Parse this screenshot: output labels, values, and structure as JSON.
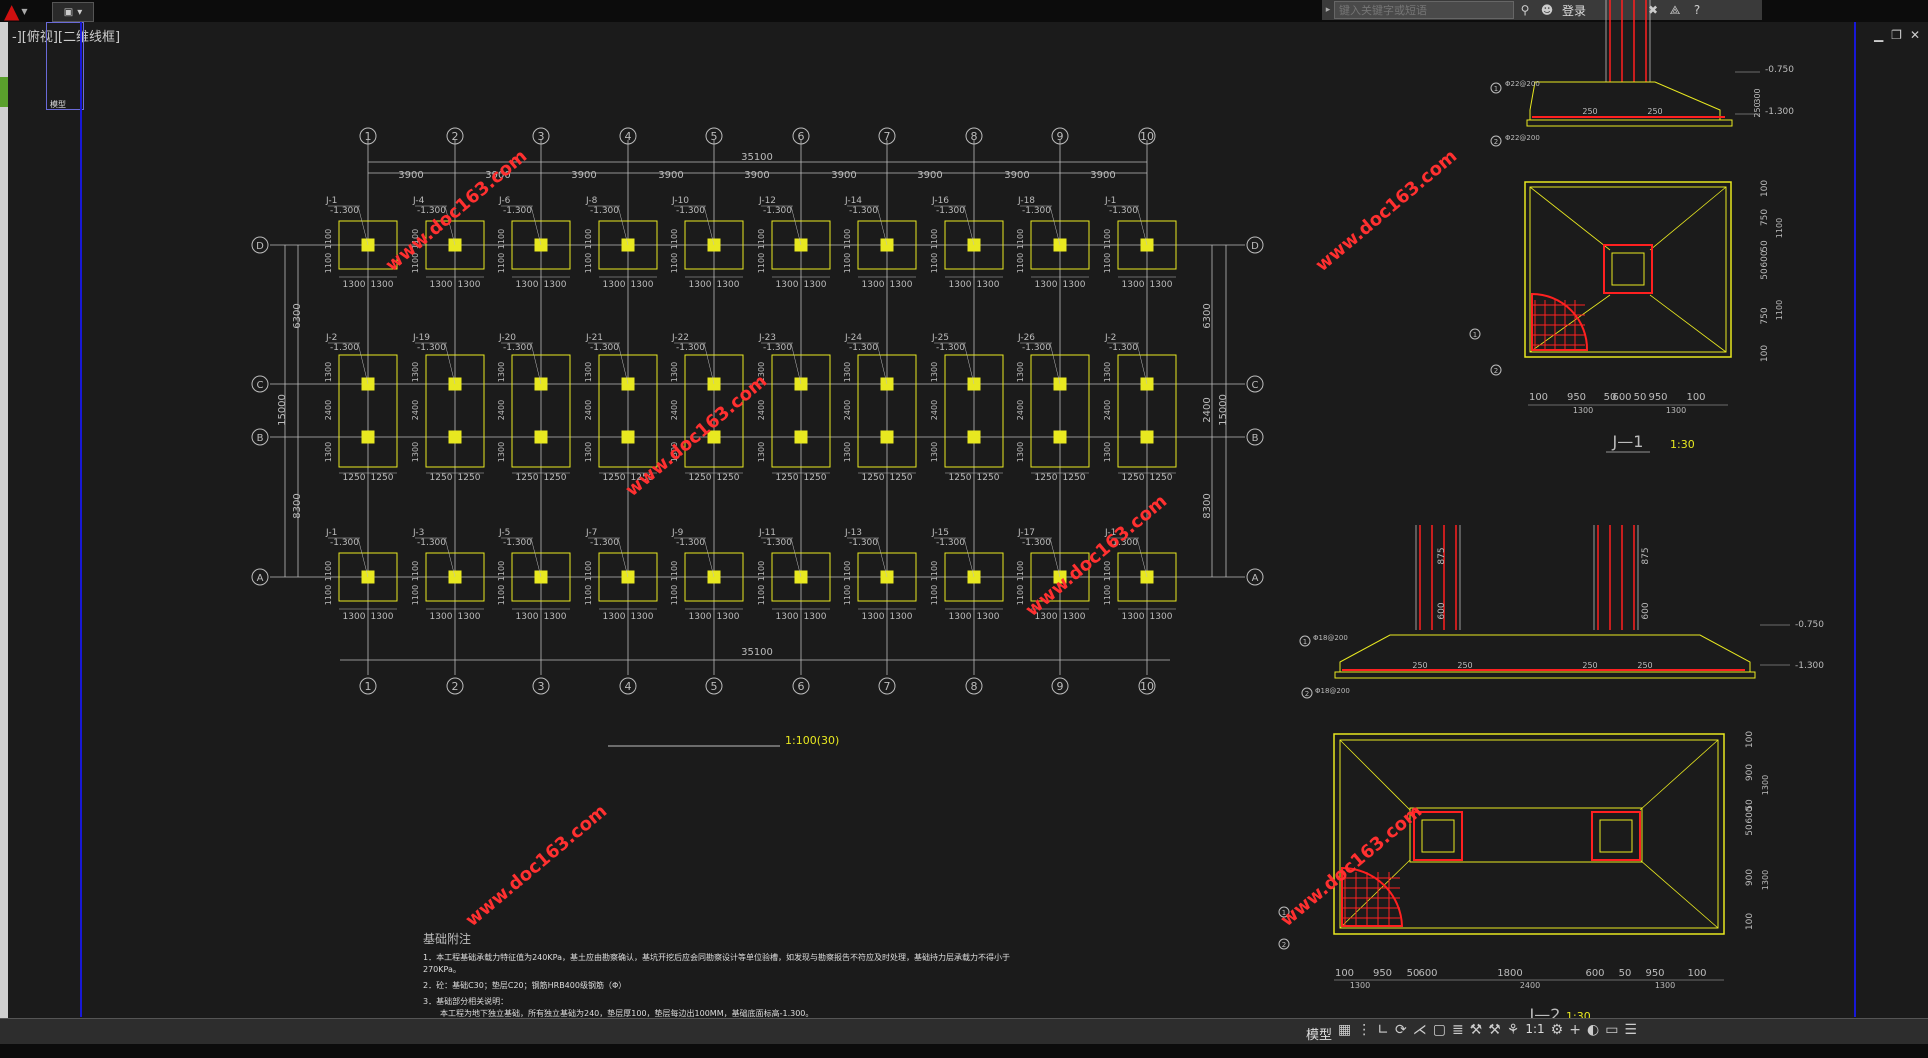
{
  "app": {
    "search_placeholder": "键入关键字或短语",
    "login_label": "登录",
    "viewport_label": "-][俯视][二维线框]",
    "layout_label": "模型",
    "status_model": "模型",
    "status_scale": "1:1"
  },
  "plan": {
    "columns": [
      "1",
      "2",
      "3",
      "4",
      "5",
      "6",
      "7",
      "8",
      "9",
      "10"
    ],
    "rows": [
      "D",
      "C",
      "B",
      "A"
    ],
    "total_width": "35100",
    "bay": "3900",
    "row_dims_left": [
      "6300",
      "15000",
      "8300"
    ],
    "row_dims_right": [
      "6300",
      "15000",
      "8300"
    ],
    "mid_dim": "2400",
    "pad_dims": [
      "1300",
      "1300"
    ],
    "pad_dims_cb": [
      "1250",
      "1250"
    ],
    "pad_side": [
      "1100",
      "1100"
    ],
    "pad_side_cb": [
      "1300",
      "2400",
      "1300"
    ],
    "top_labels": [
      "J-1",
      "J-4",
      "J-6",
      "J-8",
      "J-10",
      "J-12",
      "J-14",
      "J-16",
      "J-18",
      "J-1"
    ],
    "mid_labels": [
      "J-2",
      "J-19",
      "J-20",
      "J-21",
      "J-22",
      "J-23",
      "J-24",
      "J-25",
      "J-26",
      "J-2"
    ],
    "bot_labels": [
      "J-1",
      "J-3",
      "J-5",
      "J-7",
      "J-9",
      "J-11",
      "J-13",
      "J-15",
      "J-17",
      "J-1"
    ],
    "elev": "-1.300",
    "scale_label": "1:100(30)"
  },
  "notes": {
    "title": "基础附注",
    "lines": [
      "1．本工程基础承载力特征值为240KPa，基土应由勘察确认，基坑开挖后应会同勘察设计等单位验槽，如发现与勘察报告不符应及时处理，基础持力层承载力不得小于",
      "270KPa。",
      "2．砼：基础C30；垫层C20；钢筋HRB400级钢筋（Φ）",
      "3．基础部分相关说明：",
      "本工程为地下独立基础，所有独立基础为240，垫层厚100，垫层每边出100MM，基础底面标高-1.300。"
    ]
  },
  "details": {
    "j1_title": "J—1",
    "j2_title": "J—2",
    "scale": "1:30",
    "elev1": "-0.750",
    "elev2": "-1.300",
    "sec_dims": [
      "250",
      "250"
    ],
    "sec_dims_j2": [
      "250",
      "250",
      "250",
      "250"
    ],
    "sec_heights": [
      "300",
      "250"
    ],
    "j2_heights": [
      "875",
      "600"
    ],
    "j1_plan_bottom": [
      "100",
      "950",
      "50",
      "600",
      "50",
      "950",
      "100"
    ],
    "j1_plan_total": [
      "1300",
      "1300"
    ],
    "j1_plan_right": [
      "100",
      "750",
      "50",
      "600",
      "50",
      "750",
      "100"
    ],
    "j1_plan_right_total": [
      "1100",
      "1100"
    ],
    "j2_plan_bottom": [
      "100",
      "950",
      "50",
      "600",
      "1800",
      "600",
      "50",
      "950",
      "100"
    ],
    "j2_plan_total": [
      "1300",
      "2400",
      "1300"
    ],
    "j2_plan_right": [
      "100",
      "900",
      "50",
      "600",
      "50",
      "900",
      "100"
    ],
    "j2_plan_right_total": [
      "1300",
      "1300"
    ],
    "bar_labels": [
      "Φ22@200",
      "Φ22@200",
      "Φ18@200",
      "Φ18@200"
    ],
    "markers": [
      "1",
      "2"
    ]
  },
  "watermarks": [
    "www.doc163.com",
    "www.doc163.com",
    "www.doc163.com",
    "www.doc163.com",
    "www.doc163.com",
    "www.doc163.com"
  ],
  "colors": {
    "background": "#1b1b1b",
    "grid": "#bcbcbc",
    "pads": "#e8e820",
    "rebar": "#ff2020",
    "watermark": "#ff3030"
  }
}
